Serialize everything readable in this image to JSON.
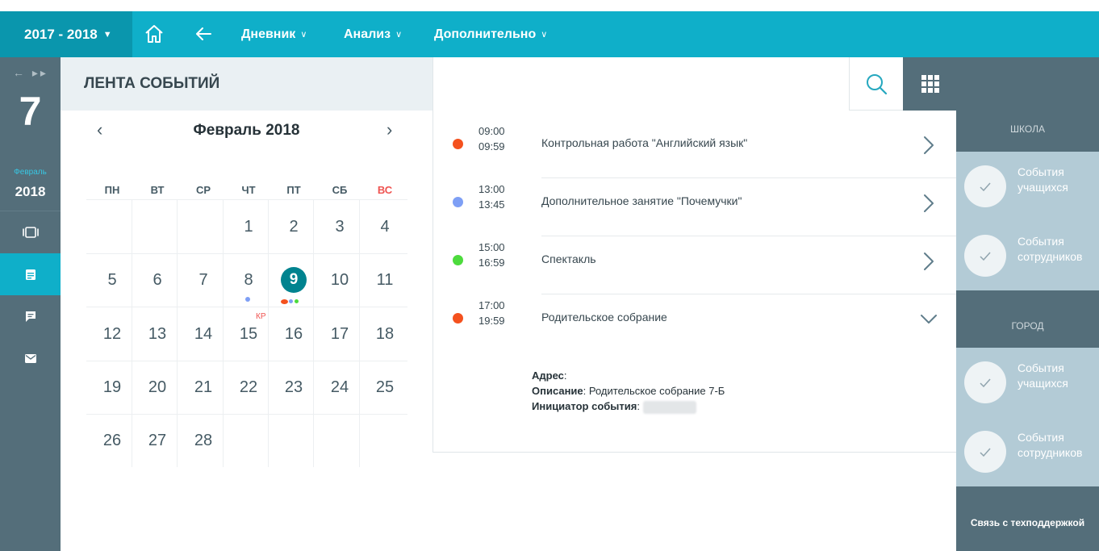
{
  "topbar": {
    "year": "2017 - 2018",
    "menu": [
      "Дневник",
      "Анализ",
      "Дополнительно"
    ]
  },
  "left": {
    "big_day": "7",
    "month": "Февраль",
    "year": "2018"
  },
  "feed": {
    "title": "ЛЕНТА СОБЫТИЙ"
  },
  "calendar": {
    "month_label": "Февраль 2018",
    "weekdays": [
      "ПН",
      "ВТ",
      "СР",
      "ЧТ",
      "ПТ",
      "СБ",
      "ВС"
    ],
    "days": [
      "1",
      "2",
      "3",
      "4",
      "5",
      "6",
      "7",
      "8",
      "9",
      "10",
      "11",
      "12",
      "13",
      "14",
      "15",
      "16",
      "17",
      "18",
      "19",
      "20",
      "21",
      "22",
      "23",
      "24",
      "25",
      "26",
      "27",
      "28"
    ],
    "first_weekday_index": 3,
    "selected_day": "9",
    "kr_label": "КР"
  },
  "events": [
    {
      "start": "09:00",
      "end": "09:59",
      "title": "Контрольная работа \"Английский язык\"",
      "color": "#f4511e",
      "state": "collapsed"
    },
    {
      "start": "13:00",
      "end": "13:45",
      "title": "Дополнительное занятие \"Почемучки\"",
      "color": "#7e9ff5",
      "state": "collapsed"
    },
    {
      "start": "15:00",
      "end": "16:59",
      "title": "Спектакль",
      "color": "#4ddb3d",
      "state": "collapsed"
    },
    {
      "start": "17:00",
      "end": "19:59",
      "title": "Родительское собрание",
      "color": "#f4511e",
      "state": "expanded"
    }
  ],
  "details": {
    "address_label": "Адрес",
    "description_label": "Описание",
    "description_value": "Родительское собрание 7-Б",
    "initiator_label": "Инициатор события"
  },
  "right": {
    "school_label": "ШКОЛА",
    "city_label": "ГОРОД",
    "students_line1": "События",
    "students_line2": "учащихся",
    "staff_line1": "События",
    "staff_line2": "сотрудников",
    "support": "Связь с техподдержкой"
  }
}
